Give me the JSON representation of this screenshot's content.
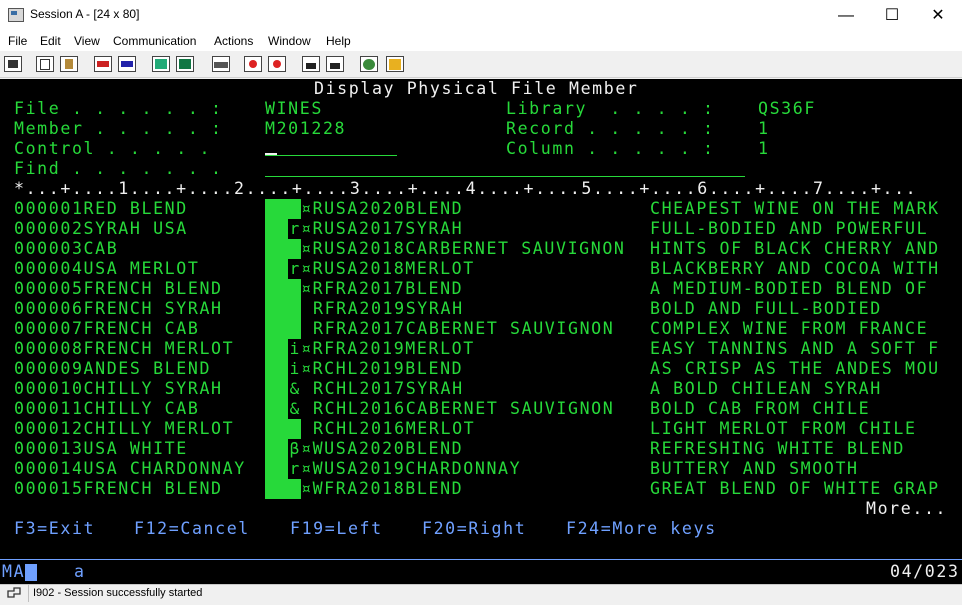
{
  "window": {
    "title": "Session A - [24 x 80]",
    "minimize": "—",
    "maximize": "☐",
    "close": "✕"
  },
  "menu": [
    "File",
    "Edit",
    "View",
    "Communication",
    "Actions",
    "Window",
    "Help"
  ],
  "toolbar_icons": [
    "print-screen-icon",
    "copy-icon",
    "paste-icon",
    "send-icon",
    "receive-icon",
    "display-icon",
    "keypad-icon",
    "keyboard-icon",
    "record-macro-icon",
    "play-macro-icon",
    "macro-a-icon",
    "macro-b-icon",
    "globe-icon",
    "notes-icon"
  ],
  "header": {
    "title": "Display Physical File Member",
    "file_label": "File . . . . . . :",
    "file_value": "WINES",
    "library_label": "Library  . . . . :",
    "library_value": "QS36F",
    "member_label": "Member . . . . . :",
    "member_value": "M201228",
    "record_label": "Record . . . . . :",
    "record_value": "1",
    "control_label": "Control . . . . .",
    "column_label": "Column . . . . . :",
    "column_value": "1",
    "find_label": "Find . . . . . . .",
    "ruler": "*...+....1....+....2....+....3....+....4....+....5....+....6....+....7....+..."
  },
  "records": [
    {
      "left": "000001RED BLEND",
      "sym": "",
      "mid": "¤RUSA2020BLEND",
      "right": "CHEAPEST WINE ON THE MARK"
    },
    {
      "left": "000002SYRAH USA",
      "sym": "r",
      "mid": "¤RUSA2017SYRAH",
      "right": "FULL-BODIED AND POWERFUL"
    },
    {
      "left": "000003CAB",
      "sym": "",
      "mid": "¤RUSA2018CARBERNET SAUVIGNON",
      "right": "HINTS OF BLACK CHERRY AND"
    },
    {
      "left": "000004USA MERLOT",
      "sym": "r",
      "mid": "¤RUSA2018MERLOT",
      "right": "BLACKBERRY AND COCOA WITH"
    },
    {
      "left": "000005FRENCH BLEND",
      "sym": "",
      "mid": "¤RFRA2017BLEND",
      "right": "A MEDIUM-BODIED BLEND OF"
    },
    {
      "left": "000006FRENCH SYRAH",
      "sym": "",
      "mid": "RFRA2019SYRAH",
      "right": "BOLD AND FULL-BODIED"
    },
    {
      "left": "000007FRENCH CAB",
      "sym": "",
      "mid": "RFRA2017CABERNET SAUVIGNON",
      "right": "COMPLEX WINE FROM FRANCE"
    },
    {
      "left": "000008FRENCH MERLOT",
      "sym": "i",
      "mid": "¤RFRA2019MERLOT",
      "right": "EASY TANNINS AND A SOFT F"
    },
    {
      "left": "000009ANDES BLEND",
      "sym": "i",
      "mid": "¤RCHL2019BLEND",
      "right": "AS CRISP AS THE ANDES MOU"
    },
    {
      "left": "000010CHILLY SYRAH",
      "sym": "&",
      "mid": "RCHL2017SYRAH",
      "right": "A BOLD CHILEAN SYRAH"
    },
    {
      "left": "000011CHILLY CAB",
      "sym": "&",
      "mid": "RCHL2016CABERNET SAUVIGNON",
      "right": "BOLD CAB FROM CHILE"
    },
    {
      "left": "000012CHILLY MERLOT",
      "sym": "",
      "mid": "RCHL2016MERLOT",
      "right": "LIGHT MERLOT FROM CHILE"
    },
    {
      "left": "000013USA WHITE",
      "sym": "β",
      "mid": "¤WUSA2020BLEND",
      "right": "REFRESHING WHITE BLEND"
    },
    {
      "left": "000014USA CHARDONNAY",
      "sym": "r",
      "mid": "¤WUSA2019CHARDONNAY",
      "right": "BUTTERY AND SMOOTH"
    },
    {
      "left": "000015FRENCH BLEND",
      "sym": "",
      "mid": "¤WFRA2018BLEND",
      "right": "GREAT BLEND OF WHITE GRAP"
    }
  ],
  "more": "More...",
  "function_keys": [
    "F3=Exit",
    "F12=Cancel",
    "F19=Left",
    "F20=Right",
    "F24=More keys"
  ],
  "status": {
    "indicator": "MA",
    "cursor_char": "a",
    "position": "04/023"
  },
  "bottom": {
    "message": "I902 - Session successfully started"
  },
  "colors": {
    "screen_bg": "#000000",
    "field_green": "#27d93a",
    "label_white": "#f0f0f0",
    "fkey_blue": "#6fa0ff"
  }
}
